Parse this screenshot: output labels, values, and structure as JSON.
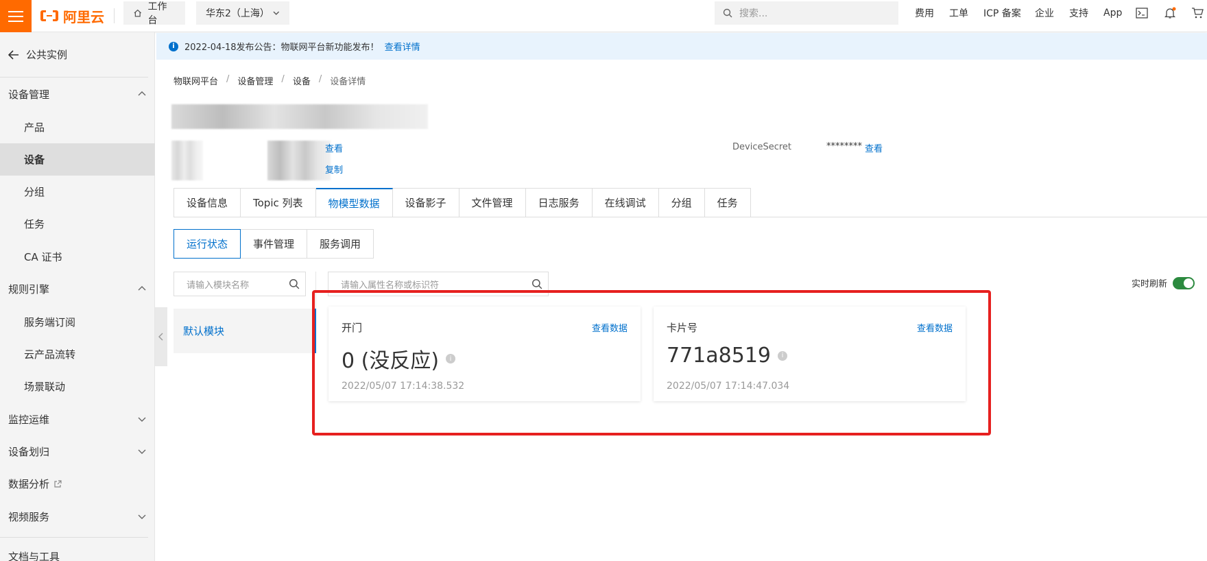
{
  "topbar": {
    "logo_text": "阿里云",
    "workbench": "工作台",
    "region": "华东2（上海）",
    "search_placeholder": "搜索...",
    "links": [
      "费用",
      "工单",
      "ICP 备案",
      "企业",
      "支持",
      "App"
    ],
    "brand_color": "#ff6a00"
  },
  "sidebar": {
    "back_label": "公共实例",
    "items": [
      {
        "label": "设备管理",
        "type": "group",
        "icon": "chevron-up-icon"
      },
      {
        "label": "产品",
        "type": "sub"
      },
      {
        "label": "设备",
        "type": "sub",
        "active": true
      },
      {
        "label": "分组",
        "type": "sub"
      },
      {
        "label": "任务",
        "type": "sub"
      },
      {
        "label": "CA 证书",
        "type": "sub"
      },
      {
        "label": "规则引擎",
        "type": "group",
        "icon": "chevron-up-icon"
      },
      {
        "label": "服务端订阅",
        "type": "sub"
      },
      {
        "label": "云产品流转",
        "type": "sub"
      },
      {
        "label": "场景联动",
        "type": "sub"
      },
      {
        "label": "监控运维",
        "type": "group",
        "icon": "chevron-down-icon"
      },
      {
        "label": "设备划归",
        "type": "group",
        "icon": "chevron-down-icon"
      },
      {
        "label": "数据分析",
        "type": "group",
        "icon": "external-link-icon"
      },
      {
        "label": "视频服务",
        "type": "group",
        "icon": "chevron-down-icon"
      },
      {
        "label": "文档与工具",
        "type": "group"
      }
    ]
  },
  "notice": {
    "text": "2022-04-18发布公告：物联网平台新功能发布！",
    "link": "查看详情"
  },
  "breadcrumb": [
    "物联网平台",
    "设备管理",
    "设备",
    "设备详情"
  ],
  "device_info": {
    "view_link": "查看",
    "copy_link": "复制",
    "secret_label": "DeviceSecret",
    "secret_value": "********",
    "secret_view": "查看"
  },
  "tabs": [
    "设备信息",
    "Topic 列表",
    "物模型数据",
    "设备影子",
    "文件管理",
    "日志服务",
    "在线调试",
    "分组",
    "任务"
  ],
  "active_tab": "物模型数据",
  "subtabs": [
    "运行状态",
    "事件管理",
    "服务调用"
  ],
  "module_search_placeholder": "请输入模块名称",
  "property_search_placeholder": "请输入属性名称或标识符",
  "module_name": "默认模块",
  "realtime_label": "实时刷新",
  "realtime_on": true,
  "accent_color": "#0070cc",
  "highlight_color": "#e6201f",
  "cards": [
    {
      "title": "开门",
      "link": "查看数据",
      "value": "0 (没反应)",
      "time": "2022/05/07 17:14:38.532"
    },
    {
      "title": "卡片号",
      "link": "查看数据",
      "value": "771a8519",
      "time": "2022/05/07 17:14:47.034"
    }
  ]
}
